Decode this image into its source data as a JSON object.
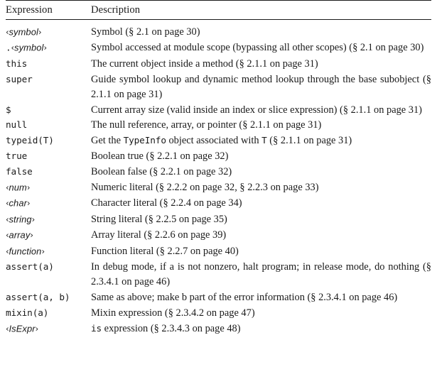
{
  "table": {
    "columns": [
      "Expression",
      "Description"
    ],
    "rows": [
      {
        "expr_kind": "meta",
        "expr": "symbol",
        "expr_prefix": "",
        "desc": "Symbol (§ 2.1 on page 30)",
        "justify": false
      },
      {
        "expr_kind": "meta",
        "expr": "symbol",
        "expr_prefix": ".",
        "desc": "Symbol accessed at module scope (bypassing all other scopes) (§ 2.1 on page 30)",
        "justify": true
      },
      {
        "expr_kind": "code",
        "expr": "this",
        "desc": "The current object inside a method (§ 2.1.1 on page 31)",
        "justify": false
      },
      {
        "expr_kind": "code",
        "expr": "super",
        "desc": "Guide symbol lookup and dynamic method lookup through the base subobject (§ 2.1.1 on page 31)",
        "justify": true
      },
      {
        "expr_kind": "code",
        "expr": "$",
        "desc": "Current array size (valid inside an index or slice expression) (§ 2.1.1 on page 31)",
        "justify": true
      },
      {
        "expr_kind": "code",
        "expr": "null",
        "desc": "The null reference, array, or pointer (§ 2.1.1 on page 31)",
        "justify": false
      },
      {
        "expr_kind": "code",
        "expr": "typeid(T)",
        "desc_parts": [
          {
            "t": "text",
            "v": "Get the "
          },
          {
            "t": "code",
            "v": "TypeInfo"
          },
          {
            "t": "text",
            "v": " object associated with "
          },
          {
            "t": "code",
            "v": "T"
          },
          {
            "t": "text",
            "v": " (§ 2.1.1 on page 31)"
          }
        ],
        "desc": "Get the TypeInfo object associated with T (§ 2.1.1 on page 31)",
        "justify": false
      },
      {
        "expr_kind": "code",
        "expr": "true",
        "desc": "Boolean true (§ 2.2.1 on page 32)",
        "justify": false
      },
      {
        "expr_kind": "code",
        "expr": "false",
        "desc": "Boolean false (§ 2.2.1 on page 32)",
        "justify": false
      },
      {
        "expr_kind": "meta",
        "expr": "num",
        "expr_prefix": "",
        "desc": "Numeric literal (§ 2.2.2 on page 32, § 2.2.3 on page 33)",
        "justify": false
      },
      {
        "expr_kind": "meta",
        "expr": "char",
        "expr_prefix": "",
        "desc": "Character literal (§ 2.2.4 on page 34)",
        "justify": false
      },
      {
        "expr_kind": "meta",
        "expr": "string",
        "expr_prefix": "",
        "desc": "String literal (§ 2.2.5 on page 35)",
        "justify": false
      },
      {
        "expr_kind": "meta",
        "expr": "array",
        "expr_prefix": "",
        "desc": "Array literal (§ 2.2.6 on page 39)",
        "justify": false
      },
      {
        "expr_kind": "meta",
        "expr": "function",
        "expr_prefix": "",
        "desc": "Function literal (§ 2.2.7 on page 40)",
        "justify": false
      },
      {
        "expr_kind": "code",
        "expr": "assert(a)",
        "desc": "In debug mode, if a is not nonzero, halt program; in release mode, do nothing (§ 2.3.4.1 on page 46)",
        "justify": true
      },
      {
        "expr_kind": "code",
        "expr": "assert(a, b)",
        "desc": "Same as above; make b part of the error information (§ 2.3.4.1 on page 46)",
        "justify": true
      },
      {
        "expr_kind": "code",
        "expr": "mixin(a)",
        "desc": "Mixin expression (§ 2.3.4.2 on page 47)",
        "justify": false
      },
      {
        "expr_kind": "meta",
        "expr": "IsExpr",
        "expr_prefix": "",
        "desc_parts": [
          {
            "t": "code",
            "v": "is"
          },
          {
            "t": "text",
            "v": " expression (§ 2.3.4.3 on page 48)"
          }
        ],
        "desc": "is expression (§ 2.3.4.3 on page 48)",
        "justify": false
      }
    ]
  },
  "glyphs": {
    "guillemet_open": "‹",
    "guillemet_close": "›",
    "section_sign": "§"
  },
  "colors": {
    "text": "#1a1a1a",
    "rule": "#1a1a1a",
    "background": "#ffffff"
  }
}
